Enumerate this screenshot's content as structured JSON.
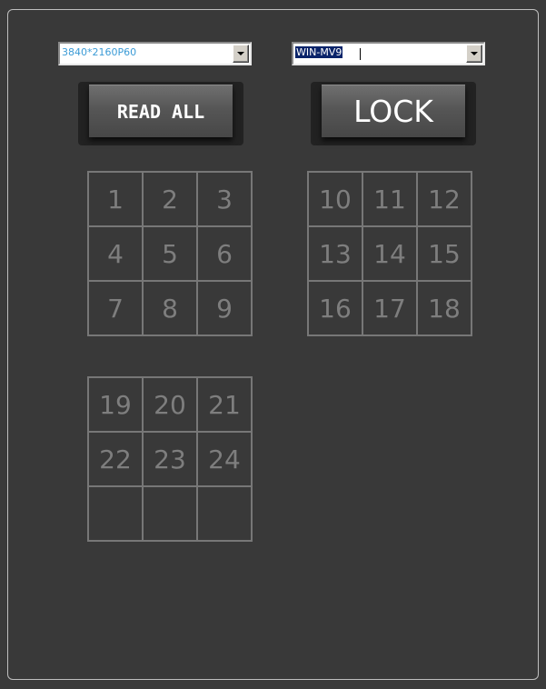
{
  "resolution_select": {
    "value": "3840*2160P60"
  },
  "layout_select": {
    "value": "WIN-MV9"
  },
  "buttons": {
    "read_all": "READ ALL",
    "lock": "LOCK"
  },
  "grids": [
    {
      "cells": [
        "1",
        "2",
        "3",
        "4",
        "5",
        "6",
        "7",
        "8",
        "9"
      ]
    },
    {
      "cells": [
        "10",
        "11",
        "12",
        "13",
        "14",
        "15",
        "16",
        "17",
        "18"
      ]
    },
    {
      "cells": [
        "19",
        "20",
        "21",
        "22",
        "23",
        "24",
        "",
        "",
        ""
      ]
    }
  ],
  "colors": {
    "panel_bg": "#393939",
    "panel_border": "#bfbfbf",
    "grid_line": "#777777",
    "cell_text": "#7e7e7e",
    "selection_bg": "#0a246a",
    "resolution_text": "#3b9bd6"
  },
  "icons": {
    "combo_dropdown": "chevron-down-icon"
  }
}
